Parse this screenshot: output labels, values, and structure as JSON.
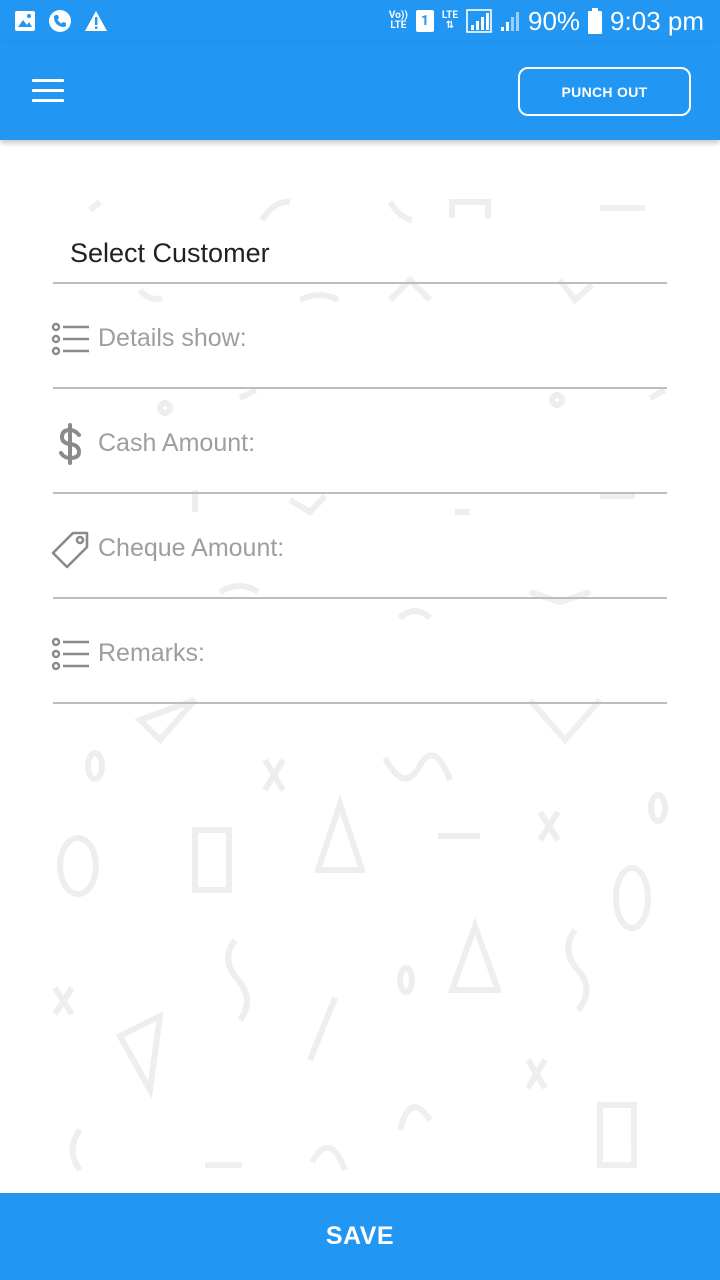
{
  "status_bar": {
    "left_icons": [
      "gallery-icon",
      "phone-icon",
      "warning-icon"
    ],
    "volte_top": "Vo))",
    "volte_bottom": "LTE",
    "sim_slot": "1",
    "lte_label": "LTE",
    "battery_percent": "90%",
    "time": "9:03 pm"
  },
  "toolbar": {
    "menu_icon": "hamburger-menu-icon",
    "punch_out_label": "PUNCH OUT"
  },
  "form": {
    "select_customer": "Select Customer",
    "fields": [
      {
        "label": "Details show:",
        "icon": "list-icon"
      },
      {
        "label": "Cash Amount:",
        "icon": "dollar-icon"
      },
      {
        "label": "Cheque Amount:",
        "icon": "tag-icon"
      },
      {
        "label": "Remarks:",
        "icon": "list-icon"
      }
    ]
  },
  "footer": {
    "save_label": "SAVE"
  },
  "colors": {
    "primary": "#2196f3",
    "divider": "#bdbdbd",
    "hint_text": "#9e9e9e",
    "icon_gray": "#8a8a8a"
  }
}
